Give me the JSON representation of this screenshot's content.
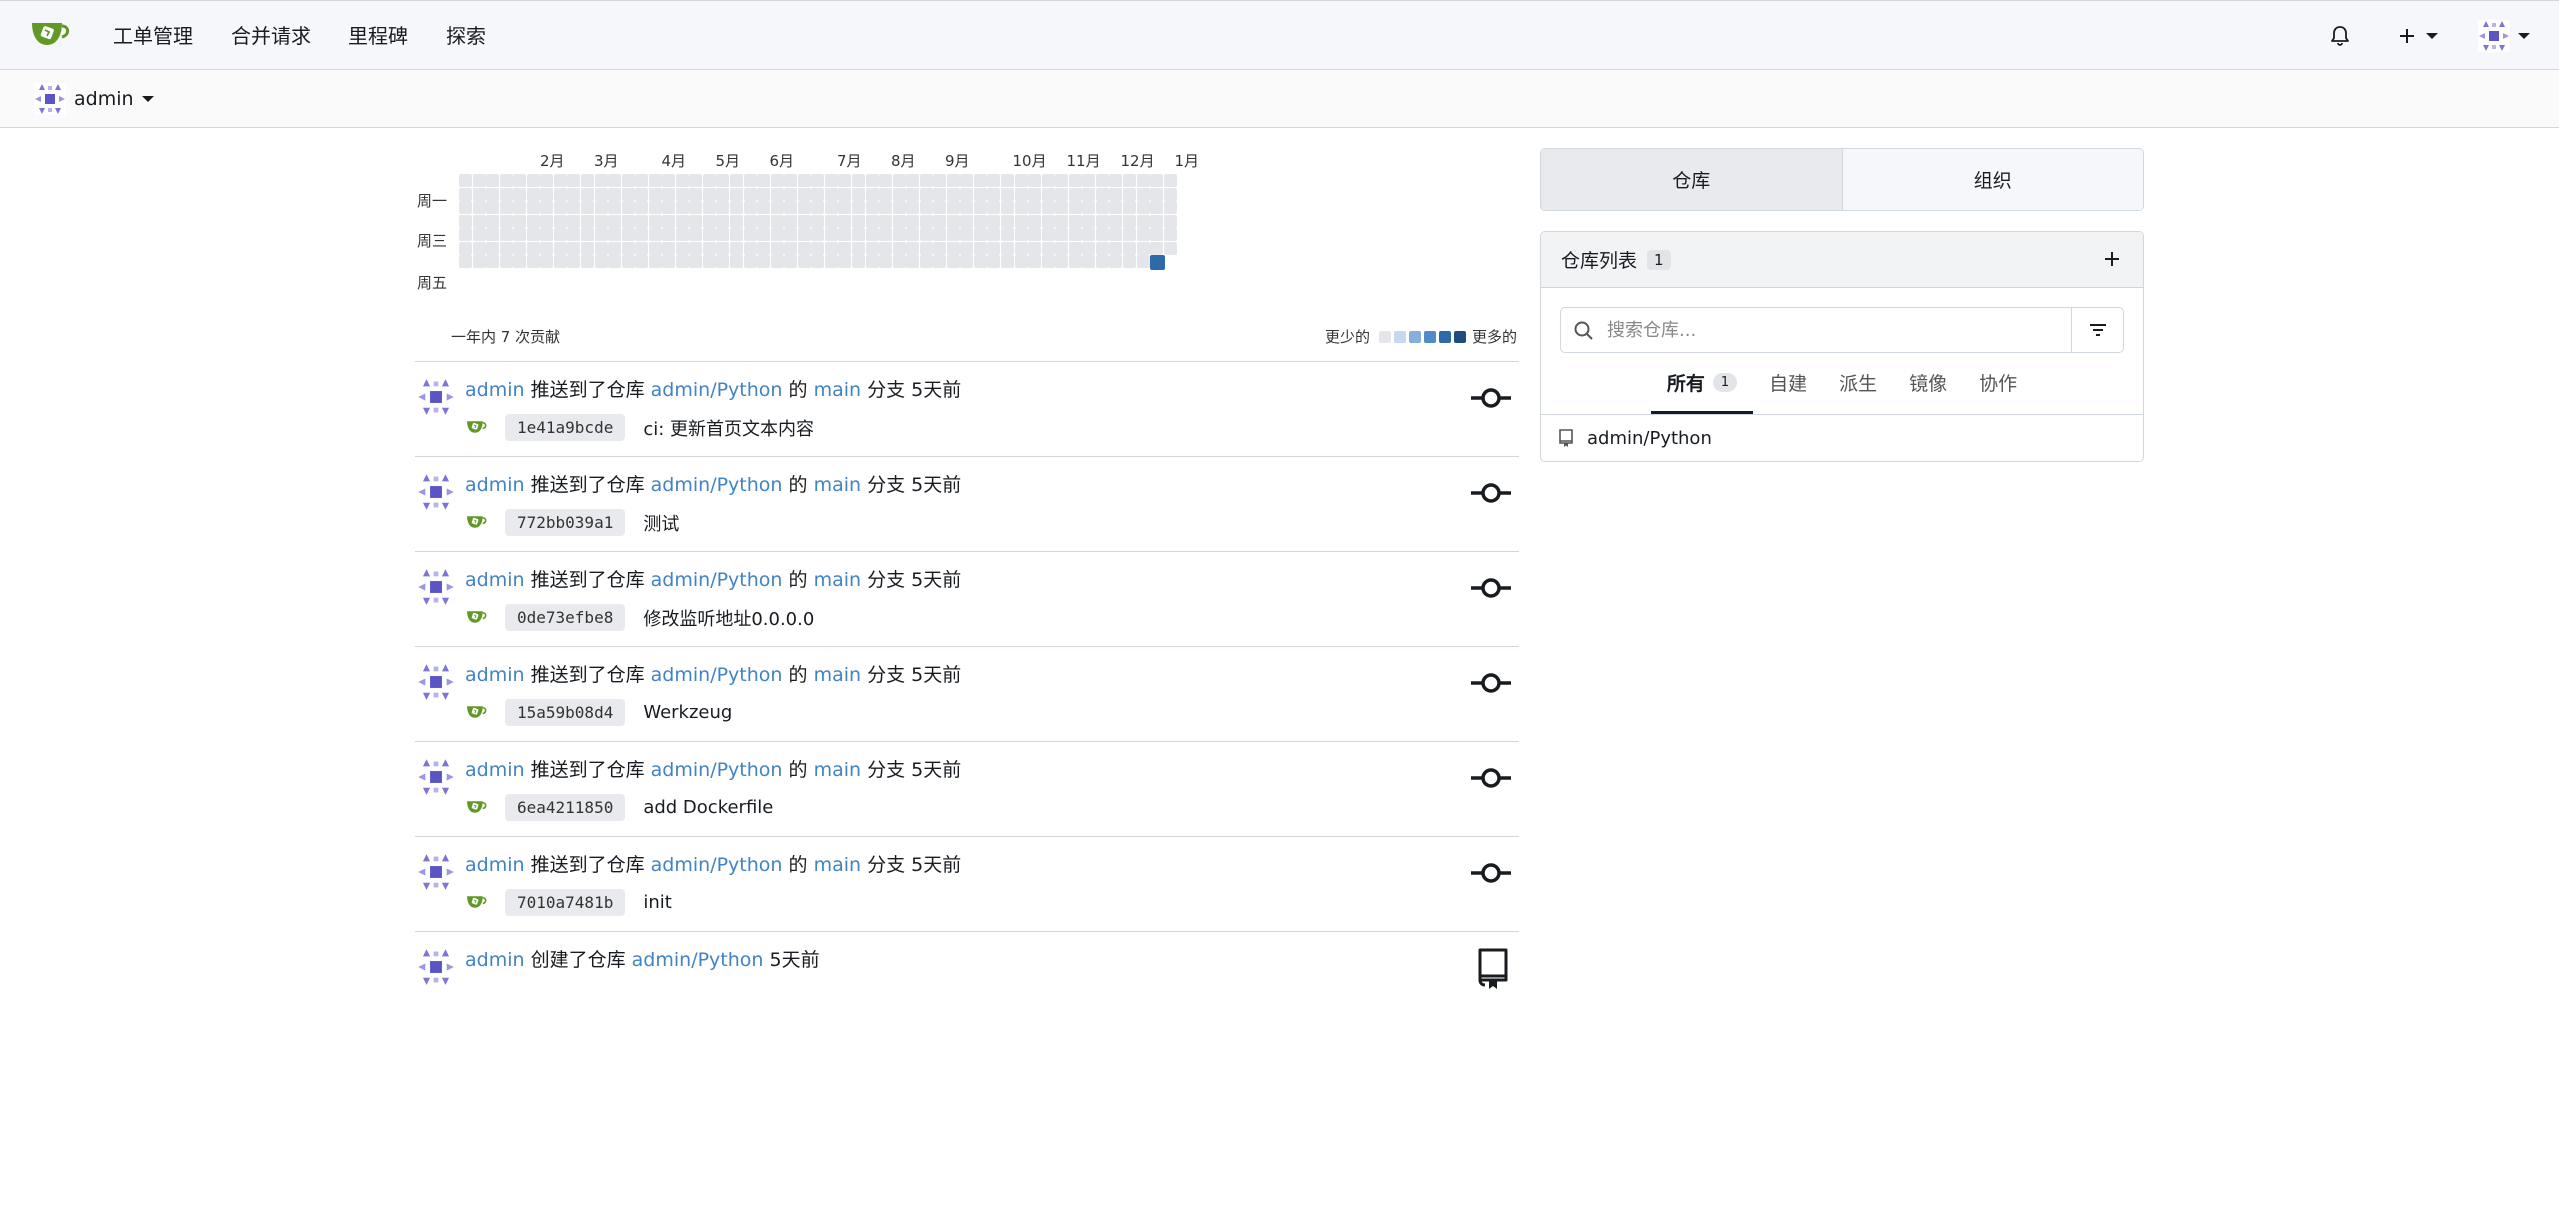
{
  "nav": {
    "items": [
      {
        "label": "工单管理"
      },
      {
        "label": "合并请求"
      },
      {
        "label": "里程碑"
      },
      {
        "label": "探索"
      }
    ]
  },
  "context": {
    "user": "admin"
  },
  "heatmap": {
    "months": [
      "2月",
      "3月",
      "4月",
      "5月",
      "6月",
      "7月",
      "8月",
      "9月",
      "10月",
      "11月",
      "12月",
      "1月"
    ],
    "weekdays": [
      "周一",
      "周三",
      "周五"
    ],
    "total": "一年内 7 次贡献",
    "less": "更少的",
    "more": "更多的",
    "colors": [
      "#e4e6ea",
      "#c6d8ef",
      "#86aedb",
      "#5289c9",
      "#2f6aa8",
      "#1e4c7f"
    ],
    "active_cell_color": "#2f6aa8"
  },
  "feed": [
    {
      "user": "admin",
      "verb": "推送到了仓库",
      "repo": "admin/Python",
      "of": "的",
      "branch": "main",
      "suffix": "分支",
      "time": "5天前",
      "sha": "1e41a9bcde",
      "message": "ci: 更新首页文本内容"
    },
    {
      "user": "admin",
      "verb": "推送到了仓库",
      "repo": "admin/Python",
      "of": "的",
      "branch": "main",
      "suffix": "分支",
      "time": "5天前",
      "sha": "772bb039a1",
      "message": "测试"
    },
    {
      "user": "admin",
      "verb": "推送到了仓库",
      "repo": "admin/Python",
      "of": "的",
      "branch": "main",
      "suffix": "分支",
      "time": "5天前",
      "sha": "0de73efbe8",
      "message": "修改监听地址0.0.0.0"
    },
    {
      "user": "admin",
      "verb": "推送到了仓库",
      "repo": "admin/Python",
      "of": "的",
      "branch": "main",
      "suffix": "分支",
      "time": "5天前",
      "sha": "15a59b08d4",
      "message": "Werkzeug"
    },
    {
      "user": "admin",
      "verb": "推送到了仓库",
      "repo": "admin/Python",
      "of": "的",
      "branch": "main",
      "suffix": "分支",
      "time": "5天前",
      "sha": "6ea4211850",
      "message": "add Dockerfile"
    },
    {
      "user": "admin",
      "verb": "推送到了仓库",
      "repo": "admin/Python",
      "of": "的",
      "branch": "main",
      "suffix": "分支",
      "time": "5天前",
      "sha": "7010a7481b",
      "message": "init"
    }
  ],
  "feed_create": {
    "user": "admin",
    "verb": "创建了仓库",
    "repo": "admin/Python",
    "time": "5天前"
  },
  "sidebar": {
    "tabs": [
      {
        "label": "仓库"
      },
      {
        "label": "组织"
      }
    ],
    "repo_list": {
      "title": "仓库列表",
      "count": "1",
      "search_placeholder": "搜索仓库...",
      "filters": [
        {
          "label": "所有",
          "count": "1"
        },
        {
          "label": "自建"
        },
        {
          "label": "派生"
        },
        {
          "label": "镜像"
        },
        {
          "label": "协作"
        }
      ],
      "repos": [
        {
          "name": "admin/Python"
        }
      ]
    }
  },
  "icons": {
    "logo": "gitea-teacup-icon",
    "notification": "bell-icon",
    "create": "plus-icon",
    "commit": "git-commit-icon",
    "repo": "repo-book-icon",
    "search": "search-icon",
    "filter": "filter-icon"
  },
  "colors": {
    "accent": "#4183c4",
    "logo_green": "#609926",
    "avatar_purple": "#6b63c9"
  }
}
